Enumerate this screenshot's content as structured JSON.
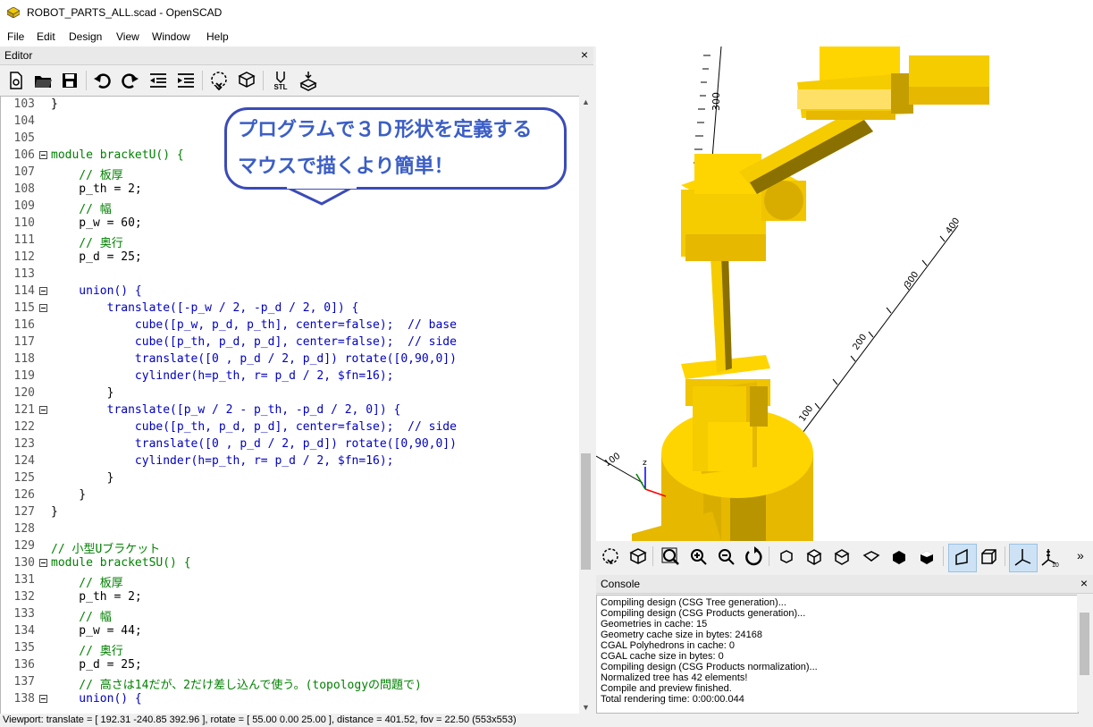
{
  "window": {
    "title": "ROBOT_PARTS_ALL.scad - OpenSCAD"
  },
  "menu": [
    "File",
    "Edit",
    "Design",
    "View",
    "Window",
    "Help"
  ],
  "editor": {
    "dock_title": "Editor",
    "close": "×",
    "lines": [
      {
        "n": "103",
        "t": "}"
      },
      {
        "n": "104",
        "t": ""
      },
      {
        "n": "105",
        "t": ""
      },
      {
        "n": "106",
        "t": "module bracketU() {"
      },
      {
        "n": "107",
        "t": "    // 板厚"
      },
      {
        "n": "108",
        "t": "    p_th = 2;"
      },
      {
        "n": "109",
        "t": "    // 幅"
      },
      {
        "n": "110",
        "t": "    p_w = 60;"
      },
      {
        "n": "111",
        "t": "    // 奥行"
      },
      {
        "n": "112",
        "t": "    p_d = 25;"
      },
      {
        "n": "113",
        "t": ""
      },
      {
        "n": "114",
        "t": "    union() {"
      },
      {
        "n": "115",
        "t": "        translate([-p_w / 2, -p_d / 2, 0]) {"
      },
      {
        "n": "116",
        "t": "            cube([p_w, p_d, p_th], center=false);  // base"
      },
      {
        "n": "117",
        "t": "            cube([p_th, p_d, p_d], center=false);  // side"
      },
      {
        "n": "118",
        "t": "            translate([0 , p_d / 2, p_d]) rotate([0,90,0])"
      },
      {
        "n": "119",
        "t": "            cylinder(h=p_th, r= p_d / 2, $fn=16);"
      },
      {
        "n": "120",
        "t": "        }"
      },
      {
        "n": "121",
        "t": "        translate([p_w / 2 - p_th, -p_d / 2, 0]) {"
      },
      {
        "n": "122",
        "t": "            cube([p_th, p_d, p_d], center=false);  // side"
      },
      {
        "n": "123",
        "t": "            translate([0 , p_d / 2, p_d]) rotate([0,90,0])"
      },
      {
        "n": "124",
        "t": "            cylinder(h=p_th, r= p_d / 2, $fn=16);"
      },
      {
        "n": "125",
        "t": "        }"
      },
      {
        "n": "126",
        "t": "    }"
      },
      {
        "n": "127",
        "t": "}"
      },
      {
        "n": "128",
        "t": ""
      },
      {
        "n": "129",
        "t": "// 小型Uブラケット"
      },
      {
        "n": "130",
        "t": "module bracketSU() {"
      },
      {
        "n": "131",
        "t": "    // 板厚"
      },
      {
        "n": "132",
        "t": "    p_th = 2;"
      },
      {
        "n": "133",
        "t": "    // 幅"
      },
      {
        "n": "134",
        "t": "    p_w = 44;"
      },
      {
        "n": "135",
        "t": "    // 奥行"
      },
      {
        "n": "136",
        "t": "    p_d = 25;"
      },
      {
        "n": "137",
        "t": "    // 高さは14だが、2だけ差し込んで使う。(topologyの問題で)"
      },
      {
        "n": "138",
        "t": "    union() {"
      }
    ]
  },
  "annotation": {
    "line1": "プログラムで３Ｄ形状を定義する",
    "line2": "マウスで描くより簡単！"
  },
  "viewer": {
    "axis_labels": [
      "300",
      "100",
      "200",
      "300",
      "400",
      "100",
      "z"
    ]
  },
  "console": {
    "dock_title": "Console",
    "close": "×",
    "lines": [
      "Compiling design (CSG Tree generation)...",
      "Compiling design (CSG Products generation)...",
      "Geometries in cache: 15",
      "Geometry cache size in bytes: 24168",
      "CGAL Polyhedrons in cache: 0",
      "CGAL cache size in bytes: 0",
      "Compiling design (CSG Products normalization)...",
      "Normalized tree has 42 elements!",
      "Compile and preview finished.",
      "Total rendering time: 0:00:00.044"
    ]
  },
  "status": {
    "text": "Viewport: translate = [ 192.31 -240.85 392.96 ], rotate = [ 55.00 0.00 25.00 ], distance = 401.52, fov = 22.50 (553x553)"
  },
  "toolbar": {
    "stl_label": "STL",
    "overflow": "»"
  },
  "colors": {
    "part_fill": "#f5cc00",
    "part_dark": "#a88a00",
    "bubble_border": "#3b4bb8",
    "bubble_text": "#3b5ec6"
  }
}
